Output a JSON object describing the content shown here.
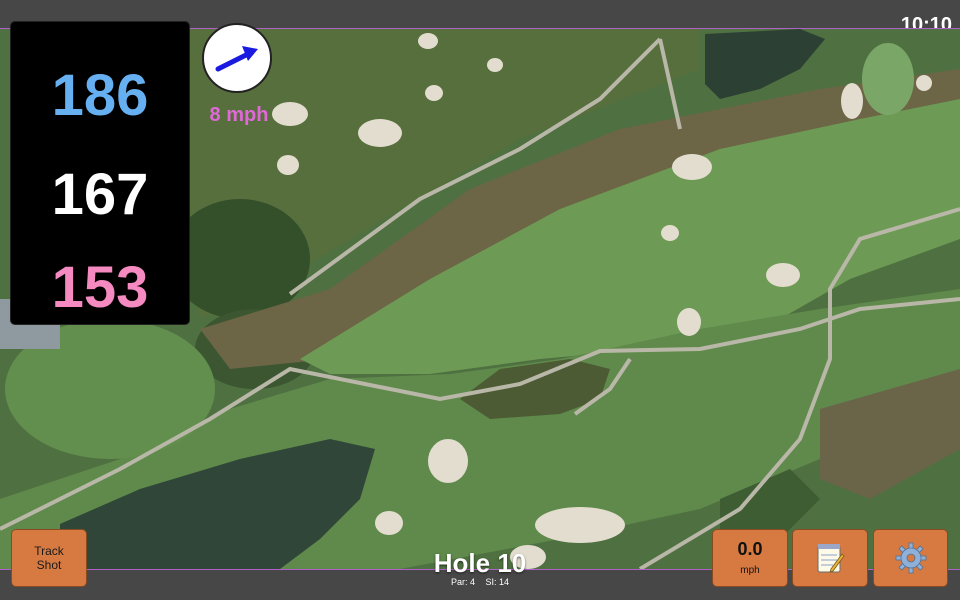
{
  "status_bar": {
    "time": "10:10"
  },
  "distances": {
    "back": "186",
    "middle": "167",
    "front": "153"
  },
  "wind": {
    "speed": "8 mph",
    "direction_icon": "arrow-northeast-icon"
  },
  "buttons": {
    "track_shot_line1": "Track",
    "track_shot_line2": "Shot",
    "speed_value": "0.0",
    "speed_unit": "mph",
    "notes_icon": "notepad-icon",
    "settings_icon": "gear-icon"
  },
  "hole": {
    "title": "Hole 10",
    "par": "Par: 4",
    "si": "SI: 14"
  },
  "colors": {
    "back_distance": "#66b0f2",
    "middle_distance": "#ffffff",
    "front_distance": "#f48ac0",
    "wind_text": "#e268d9",
    "button_bg": "#d67a42",
    "fairway": "#5e8a4d",
    "rough": "#4a6b38",
    "water": "#2f4638"
  }
}
